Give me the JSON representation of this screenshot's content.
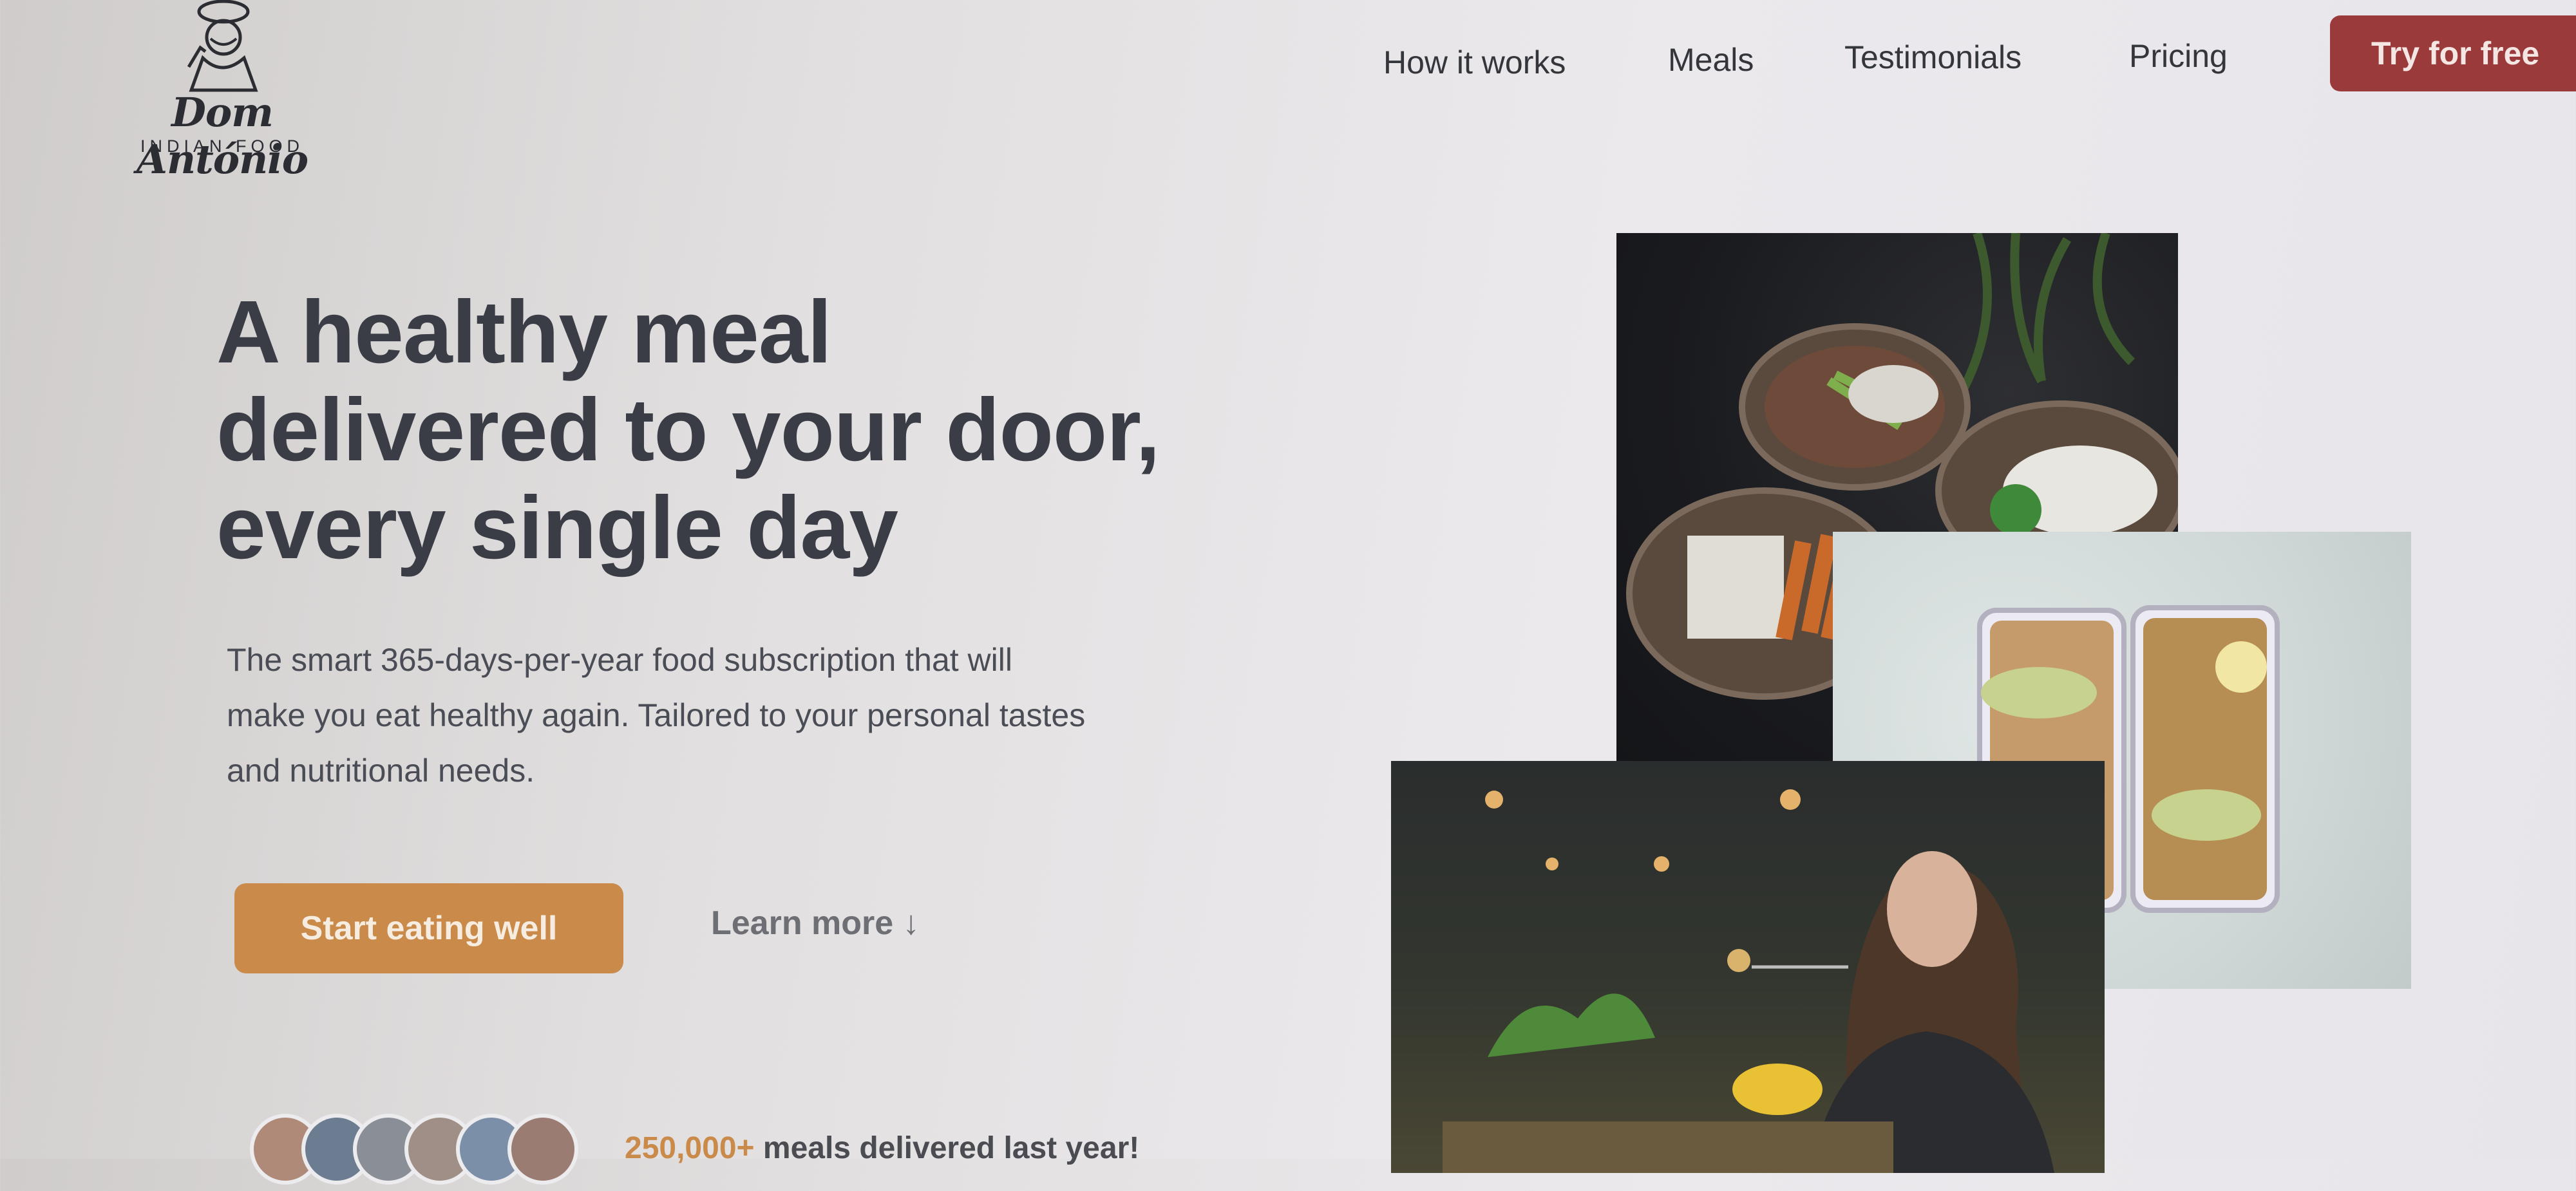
{
  "brand": {
    "name": "Dom António",
    "tagline": "INDIAN FOOD"
  },
  "nav": {
    "items": [
      {
        "label": "How it works"
      },
      {
        "label": "Meals"
      },
      {
        "label": "Testimonials"
      },
      {
        "label": "Pricing"
      }
    ],
    "cta_label": "Try for free"
  },
  "hero": {
    "title_lines": [
      "A healthy meal",
      "delivered to your door,",
      "every single day"
    ],
    "description_lines": [
      "The smart 365-days-per-year food subscription that will",
      "make you eat healthy again. Tailored to your personal tastes",
      "and nutritional needs."
    ],
    "primary_cta": "Start eating well",
    "secondary_cta": "Learn more ↓"
  },
  "delivered": {
    "count": "250,000+",
    "text": "meals delivered last year!"
  },
  "colors": {
    "brand_red": "#9b3a3a",
    "accent_orange": "#c98a4a",
    "heading": "#3a3d45"
  }
}
